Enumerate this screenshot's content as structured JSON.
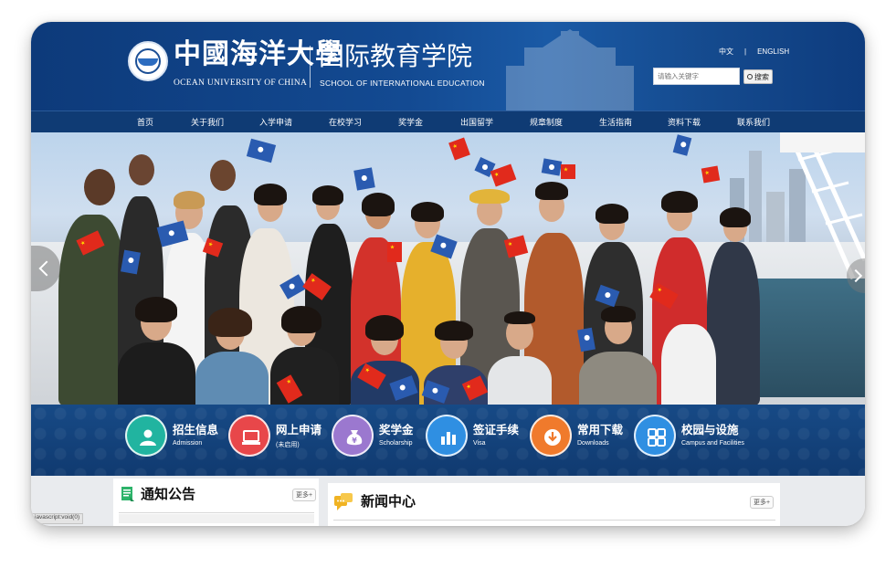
{
  "header": {
    "university_cn": "中國海洋大學",
    "university_en": "OCEAN UNIVERSITY OF CHINA",
    "school_cn": "国际教育学院",
    "school_en": "SCHOOL OF INTERNATIONAL EDUCATION",
    "lang_cn": "中文",
    "lang_sep": "|",
    "lang_en": "ENGLISH",
    "search_placeholder": "请输入关键字",
    "search_button": "搜索"
  },
  "nav": [
    {
      "label": "首页"
    },
    {
      "label": "关于我们"
    },
    {
      "label": "入学申请"
    },
    {
      "label": "在校学习"
    },
    {
      "label": "奖学金"
    },
    {
      "label": "出国留学"
    },
    {
      "label": "规章制度"
    },
    {
      "label": "生活指南"
    },
    {
      "label": "资料下载"
    },
    {
      "label": "联系我们"
    }
  ],
  "quick_links": [
    {
      "title": "招生信息",
      "subtitle": "Admission",
      "icon": "person-icon",
      "color": "#21b4a0"
    },
    {
      "title": "网上申请",
      "subtitle": "(未启用)",
      "icon": "laptop-icon",
      "color": "#e8474a"
    },
    {
      "title": "奖学金",
      "subtitle": "Scholarship",
      "icon": "money-bag-icon",
      "color": "#9b78cf"
    },
    {
      "title": "签证手续",
      "subtitle": "Visa",
      "icon": "bar-chart-icon",
      "color": "#2f8fe2"
    },
    {
      "title": "常用下载",
      "subtitle": "Downloads",
      "icon": "download-icon",
      "color": "#f07a2c"
    },
    {
      "title": "校园与设施",
      "subtitle": "Campus and Facilities",
      "icon": "grid-icon",
      "color": "#2f8fe2"
    }
  ],
  "notices": {
    "title": "通知公告",
    "more": "更多+"
  },
  "news": {
    "title": "新闻中心",
    "more": "更多+"
  },
  "status_bar": "javascript:void(0)"
}
